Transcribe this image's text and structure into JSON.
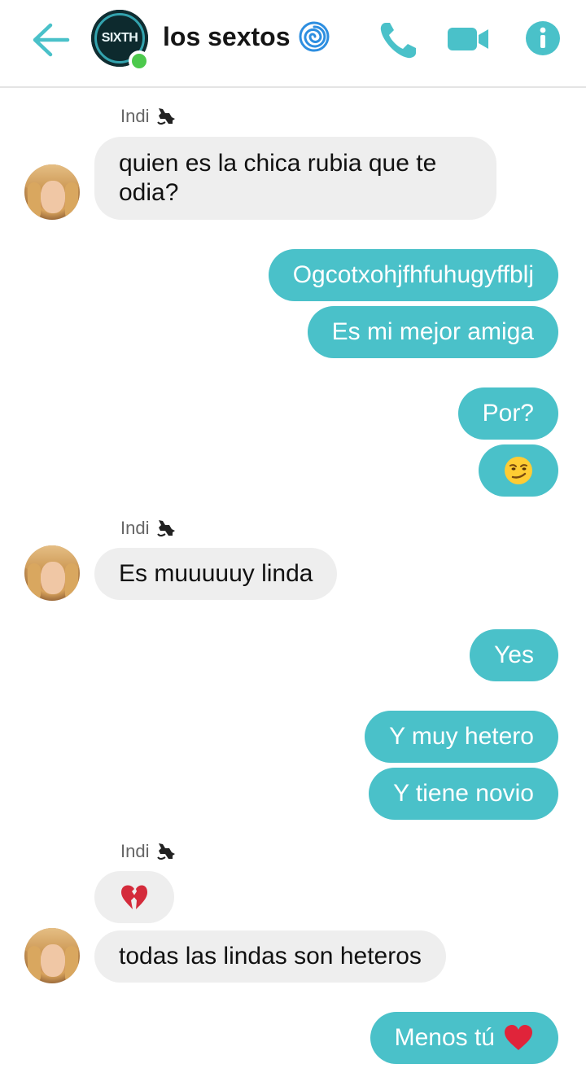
{
  "header": {
    "title": "los sextos",
    "group_logo_text": "SIXTH",
    "title_icon": "cyclone-icon",
    "accent_color": "#4ac1c9",
    "online_color": "#4cc94c"
  },
  "sender_name": "Indi",
  "messages": [
    {
      "id": "m1",
      "dir": "in",
      "sender": "Indi",
      "text": "quien es la chica rubia que te odia?"
    },
    {
      "id": "m2",
      "dir": "out",
      "text": "Ogcotxohjfhfuhugyffblj"
    },
    {
      "id": "m3",
      "dir": "out",
      "text": "Es mi mejor amiga"
    },
    {
      "id": "m4",
      "dir": "out",
      "text": "Por?"
    },
    {
      "id": "m5",
      "dir": "out",
      "text": "",
      "emoji": "smirking-face"
    },
    {
      "id": "m6",
      "dir": "in",
      "sender": "Indi",
      "text": "Es muuuuuy linda"
    },
    {
      "id": "m7",
      "dir": "out",
      "text": "Yes"
    },
    {
      "id": "m8",
      "dir": "out",
      "text": "Y muy hetero"
    },
    {
      "id": "m9",
      "dir": "out",
      "text": "Y tiene novio"
    },
    {
      "id": "m10",
      "dir": "in",
      "sender": "Indi",
      "text": "",
      "emoji": "broken-heart"
    },
    {
      "id": "m11",
      "dir": "in",
      "text": "todas las lindas son heteros"
    },
    {
      "id": "m12",
      "dir": "out",
      "text": "Menos tú",
      "emoji": "red-heart"
    }
  ],
  "colors": {
    "incoming_bubble": "#eeeeee",
    "outgoing_bubble": "#4ac1c9"
  }
}
